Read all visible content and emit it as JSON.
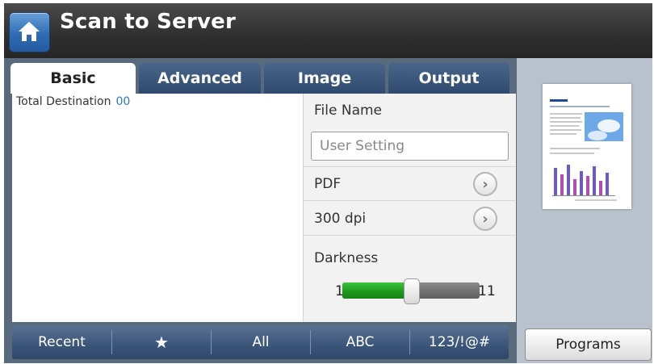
{
  "header": {
    "title": "Scan to Server",
    "home_icon": "home-icon"
  },
  "tabs": [
    {
      "label": "Basic",
      "active": true
    },
    {
      "label": "Advanced",
      "active": false
    },
    {
      "label": "Image",
      "active": false
    },
    {
      "label": "Output",
      "active": false
    }
  ],
  "destination": {
    "label": "Total Destination",
    "count": "00"
  },
  "settings": {
    "file_name_label": "File Name",
    "file_name_value": "User Setting",
    "format_value": "PDF",
    "resolution_value": "300 dpi",
    "darkness_label": "Darkness",
    "darkness_min": "1",
    "darkness_max": "11",
    "darkness_level_fraction": 0.5
  },
  "bottom_bar": [
    {
      "label": "Recent"
    },
    {
      "label": "★"
    },
    {
      "label": "All"
    },
    {
      "label": "ABC"
    },
    {
      "label": "123/!@#"
    }
  ],
  "programs_button": "Programs",
  "colors": {
    "header": "#2f2f2f",
    "tab": "#2f4a6e",
    "accent_blue": "#2a77c9",
    "slider_fill": "#1f9a1f"
  }
}
